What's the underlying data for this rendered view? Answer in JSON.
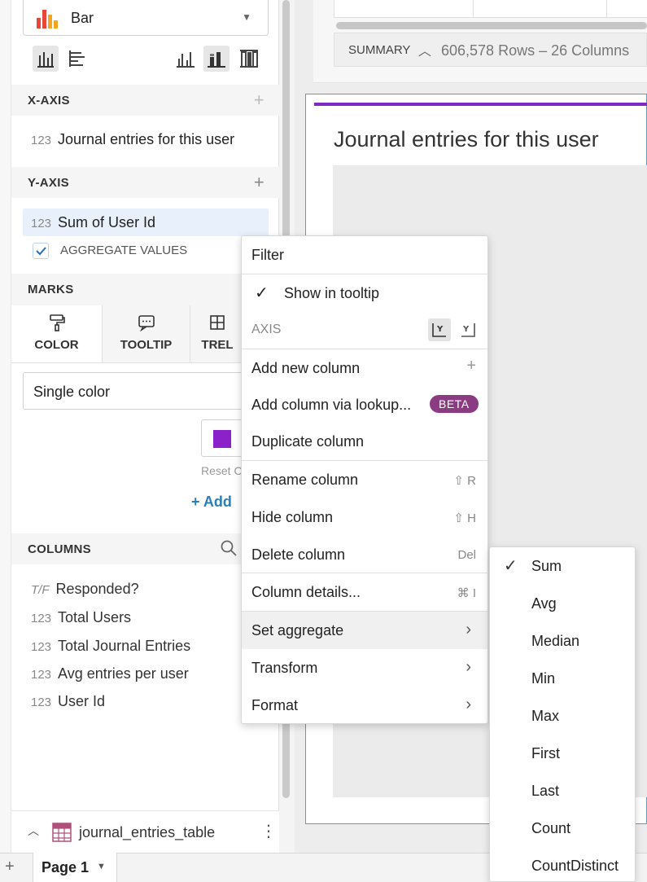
{
  "chart_type": {
    "label": "Bar"
  },
  "x_axis": {
    "header": "X-AXIS",
    "field_prefix": "123",
    "field_label": "Journal entries for this user"
  },
  "y_axis": {
    "header": "Y-AXIS",
    "field_prefix": "123",
    "field_label": "Sum of User Id",
    "aggregate_label": "AGGREGATE VALUES"
  },
  "marks": {
    "header": "MARKS",
    "tabs": [
      {
        "label": "COLOR"
      },
      {
        "label": "TOOLTIP"
      },
      {
        "label": "TREL"
      }
    ],
    "color_mode": "Single color",
    "swatch_color": "#8b22c9",
    "reset_label": "Reset C",
    "add_label": "+ Add"
  },
  "columns": {
    "header": "COLUMNS",
    "items": [
      {
        "prefix": "T/F",
        "label": "Responded?"
      },
      {
        "prefix": "123",
        "label": "Total Users"
      },
      {
        "prefix": "123",
        "label": "Total Journal Entries"
      },
      {
        "prefix": "123",
        "label": "Avg entries per user"
      },
      {
        "prefix": "123",
        "label": "User Id"
      }
    ]
  },
  "source": {
    "table_name": "journal_entries_table"
  },
  "summary": {
    "label": "SUMMARY",
    "stats": "606,578 Rows – 26 Columns"
  },
  "chart": {
    "title": "Journal entries for this user",
    "accent_color": "#7c2bc4"
  },
  "context_menu": {
    "filter": "Filter",
    "show_in_tooltip": "Show in tooltip",
    "axis_label": "AXIS",
    "add_new_column": "Add new column",
    "add_column_lookup": "Add column via lookup...",
    "beta_badge": "BETA",
    "duplicate_column": "Duplicate column",
    "rename_column": "Rename column",
    "rename_shortcut": "⇧ R",
    "hide_column": "Hide column",
    "hide_shortcut": "⇧ H",
    "delete_column": "Delete column",
    "delete_shortcut": "Del",
    "column_details": "Column details...",
    "details_shortcut": "⌘ I",
    "set_aggregate": "Set aggregate",
    "transform": "Transform",
    "format": "Format"
  },
  "aggregate_submenu": {
    "items": [
      "Sum",
      "Avg",
      "Median",
      "Min",
      "Max",
      "First",
      "Last",
      "Count",
      "CountDistinct"
    ],
    "selected": "Sum"
  },
  "page_tabs": {
    "current": "Page 1"
  }
}
